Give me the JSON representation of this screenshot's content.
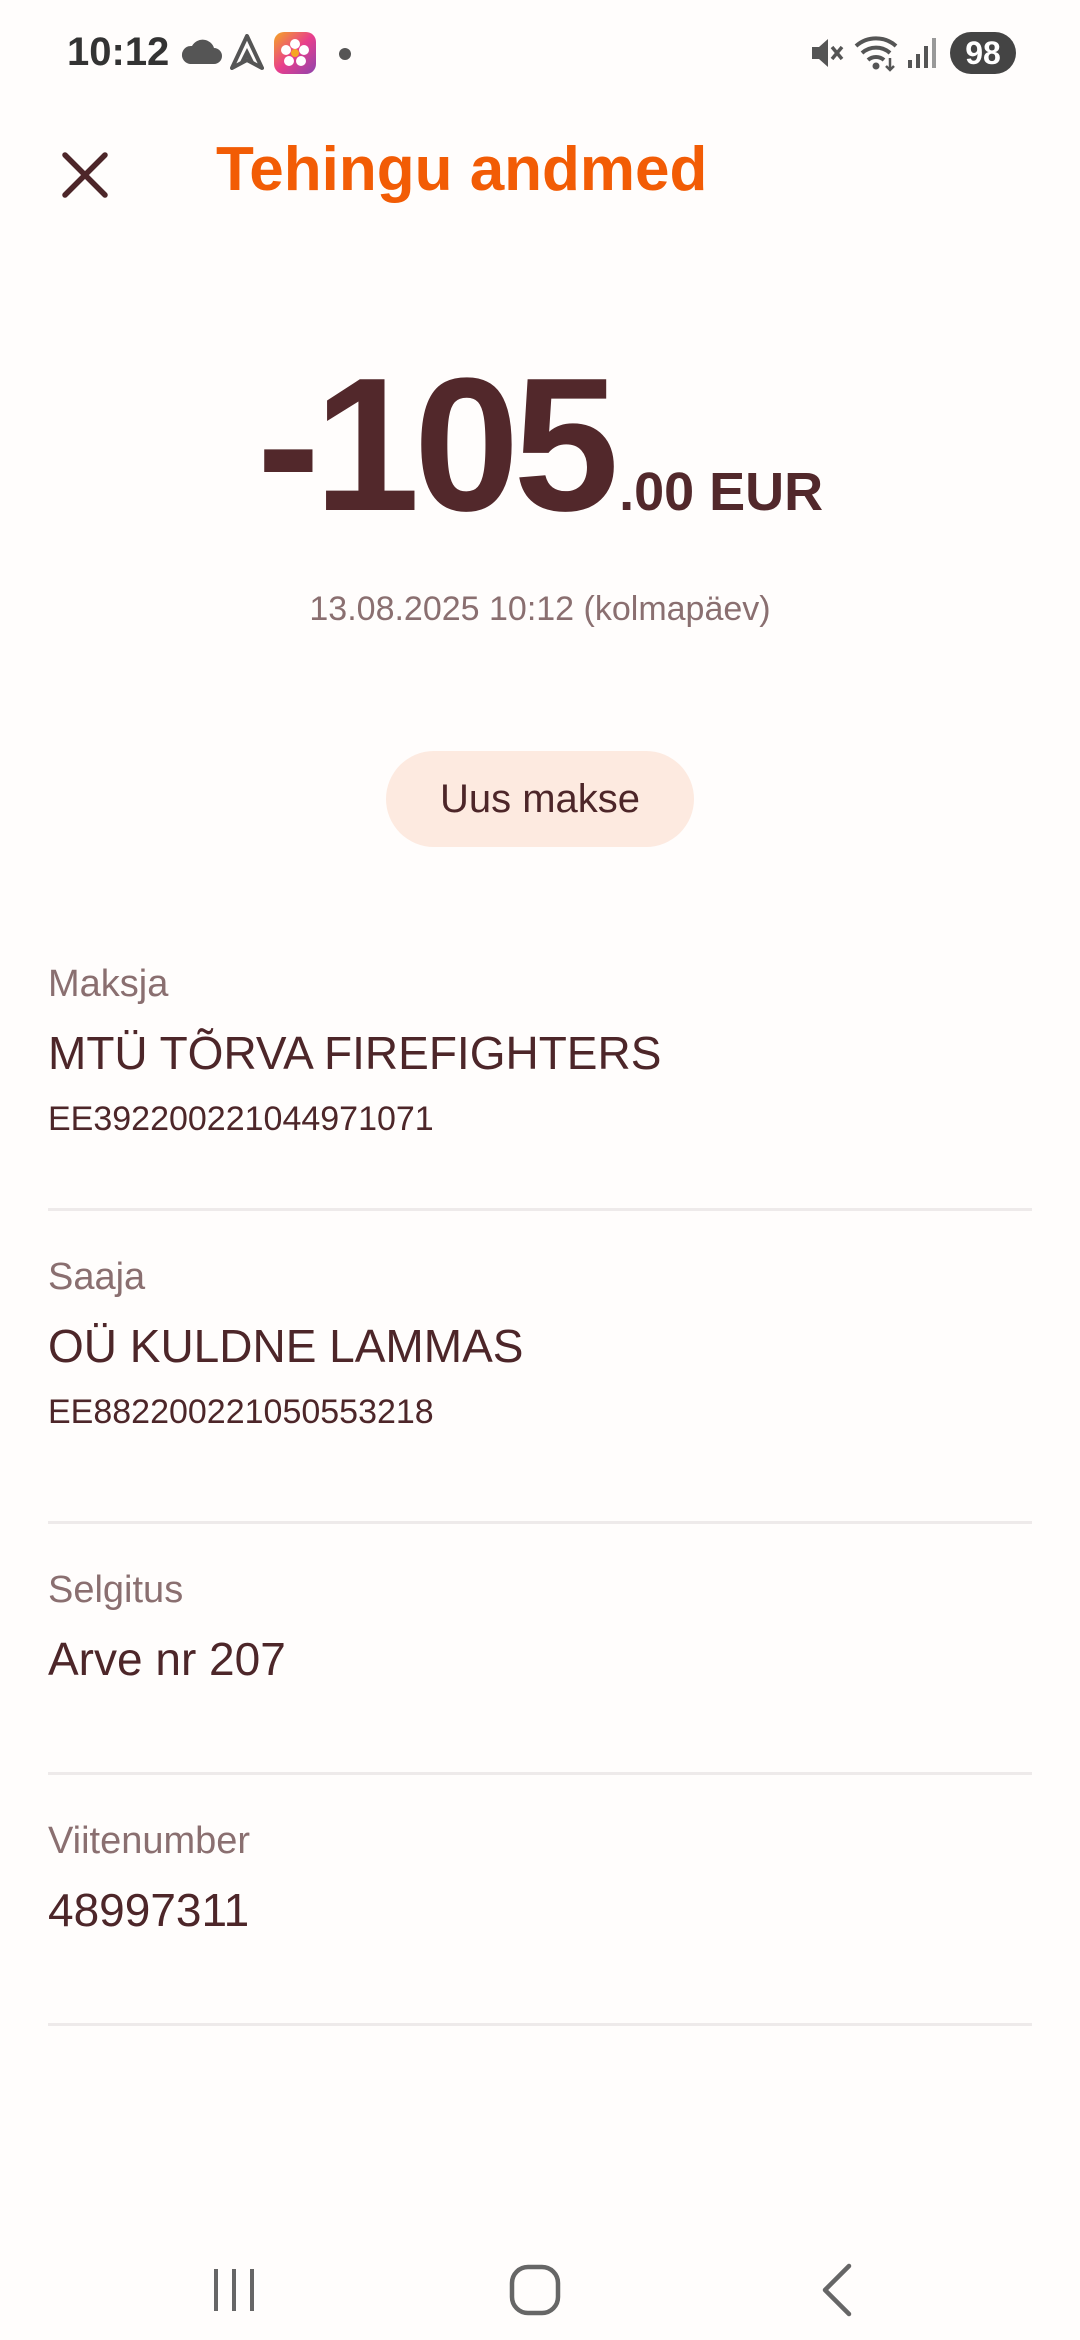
{
  "status_bar": {
    "time": "10:12",
    "battery": "98",
    "icons": [
      "cloud-icon",
      "navigation-icon",
      "flower-app-icon",
      "dot-icon",
      "mute-icon",
      "wifi-icon",
      "signal-icon",
      "battery-icon"
    ]
  },
  "header": {
    "title": "Tehingu andmed",
    "close_icon": "close-icon"
  },
  "transaction": {
    "amount_integer": "-105",
    "amount_decimal": ".00 EUR",
    "datetime": "13.08.2025 10:12 (kolmapäev)",
    "new_payment_label": "Uus makse"
  },
  "details": {
    "payer": {
      "label": "Maksja",
      "name": "MTÜ TÕRVA FIREFIGHTERS",
      "iban": "EE392200221044971071"
    },
    "recipient": {
      "label": "Saaja",
      "name": "OÜ KULDNE LAMMAS",
      "iban": "EE882200221050553218"
    },
    "description": {
      "label": "Selgitus",
      "value": "Arve nr 207"
    },
    "reference": {
      "label": "Viitenumber",
      "value": "48997311"
    }
  },
  "nav": {
    "icons": [
      "recent-apps-icon",
      "home-icon",
      "back-icon"
    ]
  },
  "colors": {
    "accent": "#f25c05",
    "text_primary": "#4d2629",
    "text_secondary": "#8a6f70",
    "button_bg": "#fdeae0"
  }
}
